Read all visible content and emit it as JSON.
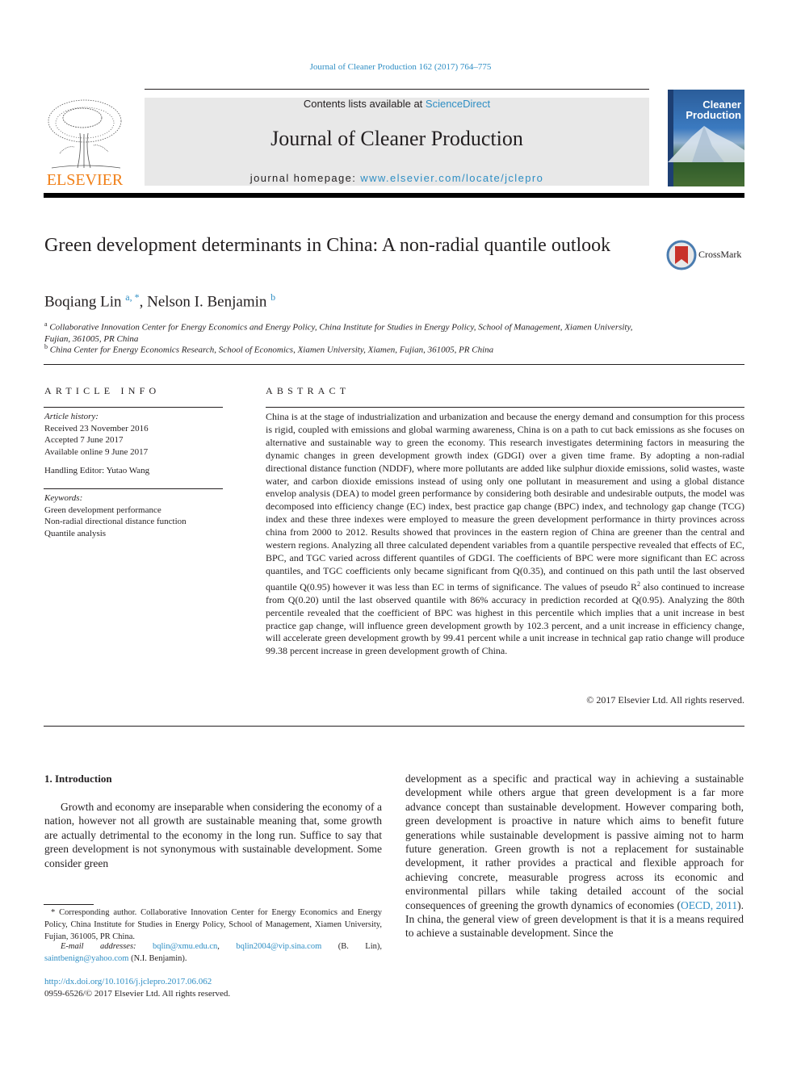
{
  "header": {
    "citation": "Journal of Cleaner Production 162 (2017) 764–775",
    "publisher": "ELSEVIER",
    "contents_prefix": "Contents lists available at ",
    "contents_link": "ScienceDirect",
    "journal_name": "Journal of Cleaner Production",
    "homepage_prefix": "journal homepage: ",
    "homepage_link": "www.elsevier.com/locate/jclepro",
    "cover_title_line1": "Cleaner",
    "cover_title_line2": "Production",
    "crossmark_label": "CrossMark"
  },
  "article": {
    "title": "Green development determinants in China: A non-radial quantile outlook",
    "authors": [
      {
        "name": "Boqiang Lin",
        "marks": "a, *"
      },
      {
        "name": "Nelson I. Benjamin",
        "marks": "b"
      }
    ],
    "affiliations": [
      {
        "mark": "a",
        "text": "Collaborative Innovation Center for Energy Economics and Energy Policy, China Institute for Studies in Energy Policy, School of Management, Xiamen University, Fujian, 361005, PR China"
      },
      {
        "mark": "b",
        "text": "China Center for Energy Economics Research, School of Economics, Xiamen University, Xiamen, Fujian, 361005, PR China"
      }
    ]
  },
  "article_info": {
    "heading": "ARTICLE INFO",
    "history_label": "Article history:",
    "received": "Received 23 November 2016",
    "accepted": "Accepted 7 June 2017",
    "online": "Available online 9 June 2017",
    "editor": "Handling Editor: Yutao Wang",
    "keywords_label": "Keywords:",
    "keywords": [
      "Green development performance",
      "Non-radial directional distance function",
      "Quantile analysis"
    ]
  },
  "abstract": {
    "heading": "ABSTRACT",
    "part1": "China is at the stage of industrialization and urbanization and because the energy demand and consumption for this process is rigid, coupled with emissions and global warming awareness, China is on a path to cut back emissions as she focuses on alternative and sustainable way to green the economy. This research investigates determining factors in measuring the dynamic changes in green development growth index (GDGI) over a given time frame. By adopting a non-radial directional distance function (NDDF), where more pollutants are added like sulphur dioxide emissions, solid wastes, waste water, and carbon dioxide emissions instead of using only one pollutant in measurement and using a global distance envelop analysis (DEA) to model green performance by considering both desirable and undesirable outputs, the model was decomposed into efficiency change (EC) index, best practice gap change (BPC) index, and technology gap change (TCG) index and these three indexes were employed to measure the green development performance in thirty provinces across china from 2000 to 2012. Results showed that provinces in the eastern region of China are greener than the central and western regions. Analyzing all three calculated dependent variables from a quantile perspective revealed that effects of EC, BPC, and TGC varied across different quantiles of GDGI. The coefficients of BPC were more significant than EC across quantiles, and TGC coefficients only became significant from Q(0.35), and continued on this path until the last observed quantile Q(0.95) however it was less than EC in terms of significance. The values of pseudo R",
    "sup": "2",
    "part2": " also continued to increase from Q(0.20) until the last observed quantile with 86% accuracy in prediction recorded at Q(0.95). Analyzing the 80th percentile revealed that the coefficient of BPC was highest in this percentile which implies that a unit increase in best practice gap change, will influence green development growth by 102.3 percent, and a unit increase in efficiency change, will accelerate green development growth by 99.41 percent while a unit increase in technical gap ratio change will produce 99.38 percent increase in green development growth of China.",
    "copyright": "© 2017 Elsevier Ltd. All rights reserved."
  },
  "introduction": {
    "heading": "1.  Introduction",
    "left_text": "Growth and economy are inseparable when considering the economy of a nation, however not all growth are sustainable meaning that, some growth are actually detrimental to the economy in the long run. Suffice to say that green development is not synonymous with sustainable development. Some consider green",
    "right_text_a": "development as a specific and practical way in achieving a sustainable development while others argue that green development is a far more advance concept than sustainable development. However comparing both, green development is proactive in nature which aims to benefit future generations while sustainable development is passive aiming not to harm future generation. Green growth is not a replacement for sustainable development, it rather provides a practical and flexible approach for achieving concrete, measurable progress across its economic and environmental pillars while taking detailed account of the social consequences of greening the growth dynamics of economies (",
    "right_citation": "OECD, 2011",
    "right_text_b": "). In china, the general view of green development is that it is a means required to achieve a sustainable development. Since the"
  },
  "footnotes": {
    "corresponding": "* Corresponding author. Collaborative Innovation Center for Energy Economics and Energy Policy, China Institute for Studies in Energy Policy, School of Management, Xiamen University, Fujian, 361005, PR China.",
    "email_label": "E-mail addresses:",
    "email1": "bqlin@xmu.edu.cn",
    "email2": "bqlin2004@vip.sina.com",
    "email2_suffix": " (B. Lin),",
    "email3": "saintbenign@yahoo.com",
    "email3_suffix": " (N.I. Benjamin).",
    "doi": "http://dx.doi.org/10.1016/j.jclepro.2017.06.062",
    "issn": "0959-6526/© 2017 Elsevier Ltd. All rights reserved."
  }
}
